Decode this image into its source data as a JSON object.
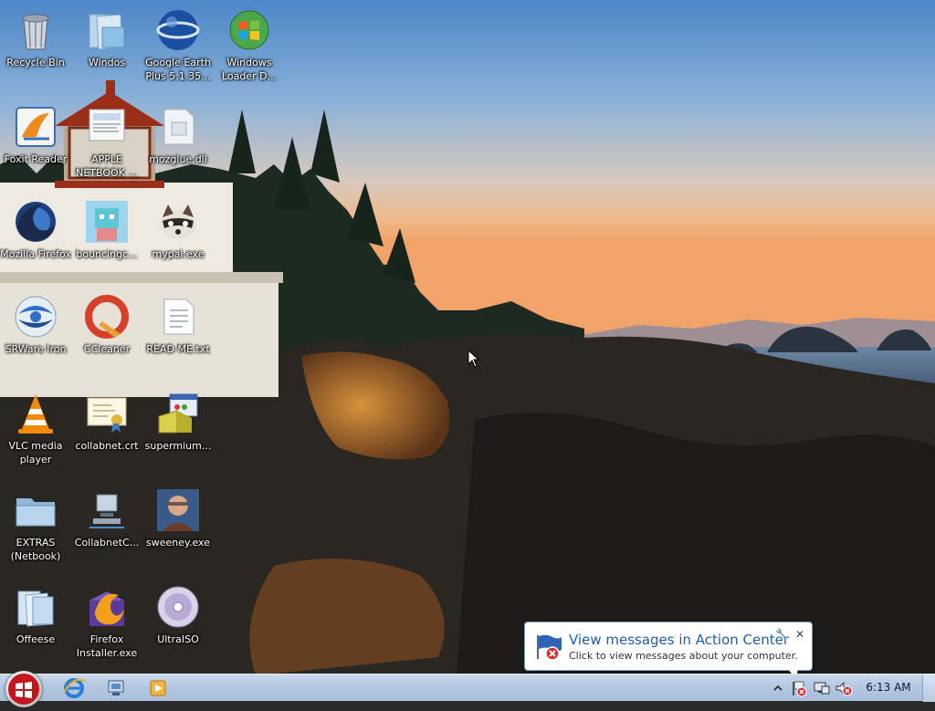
{
  "desktop": {
    "icons": [
      {
        "label": "Recycle Bin",
        "icon": "recycle-bin-icon"
      },
      {
        "label": "Windos",
        "icon": "folder-windos-icon"
      },
      {
        "label": "Google Earth Plus 5.1.35...",
        "icon": "google-earth-icon"
      },
      {
        "label": "Windows Loader D...",
        "icon": "windows-loader-icon"
      },
      {
        "label": "Foxit Reader",
        "icon": "foxit-reader-icon"
      },
      {
        "label": "APPLE NETBOOK ...",
        "icon": "apple-netbook-icon"
      },
      {
        "label": "mozglue.dll",
        "icon": "dll-file-icon"
      },
      {
        "label": "Mozilla Firefox",
        "icon": "firefox-icon"
      },
      {
        "label": "bouncingc...",
        "icon": "bouncing-game-icon"
      },
      {
        "label": "mypal.exe",
        "icon": "mypal-raccoon-icon"
      },
      {
        "label": "SRWare Iron",
        "icon": "srware-iron-icon"
      },
      {
        "label": "CCleaner",
        "icon": "ccleaner-icon"
      },
      {
        "label": "READ ME.txt",
        "icon": "text-file-icon"
      },
      {
        "label": "VLC media player",
        "icon": "vlc-cone-icon"
      },
      {
        "label": "collabnet.crt",
        "icon": "certificate-icon"
      },
      {
        "label": "supermium...",
        "icon": "installer-box-icon"
      },
      {
        "label": "EXTRAS (Netbook)",
        "icon": "folder-icon"
      },
      {
        "label": "CollabnetC...",
        "icon": "network-computer-icon"
      },
      {
        "label": "sweeney.exe",
        "icon": "person-photo-icon"
      },
      {
        "label": "Offeese",
        "icon": "office-folder-icon"
      },
      {
        "label": "Firefox Installer.exe",
        "icon": "firefox-installer-icon"
      },
      {
        "label": "UltraISO",
        "icon": "disc-icon"
      }
    ]
  },
  "taskbar": {
    "pinned": [
      {
        "icon": "internet-explorer-icon"
      },
      {
        "icon": "windows-explorer-icon"
      },
      {
        "icon": "media-player-icon"
      }
    ],
    "tray": [
      {
        "icon": "show-hidden-icons-chevron-icon"
      },
      {
        "icon": "action-center-flag-error-icon"
      },
      {
        "icon": "network-icon"
      },
      {
        "icon": "volume-muted-icon"
      }
    ],
    "clock": "6:13 AM"
  },
  "balloon": {
    "title": "View messages in Action Center",
    "body": "Click to view messages about your computer.",
    "close_glyph": "✕",
    "pin_glyph": "🔧"
  },
  "colors": {
    "balloon_title": "#1d5fa8",
    "taskbar": "#b4c8e2"
  }
}
